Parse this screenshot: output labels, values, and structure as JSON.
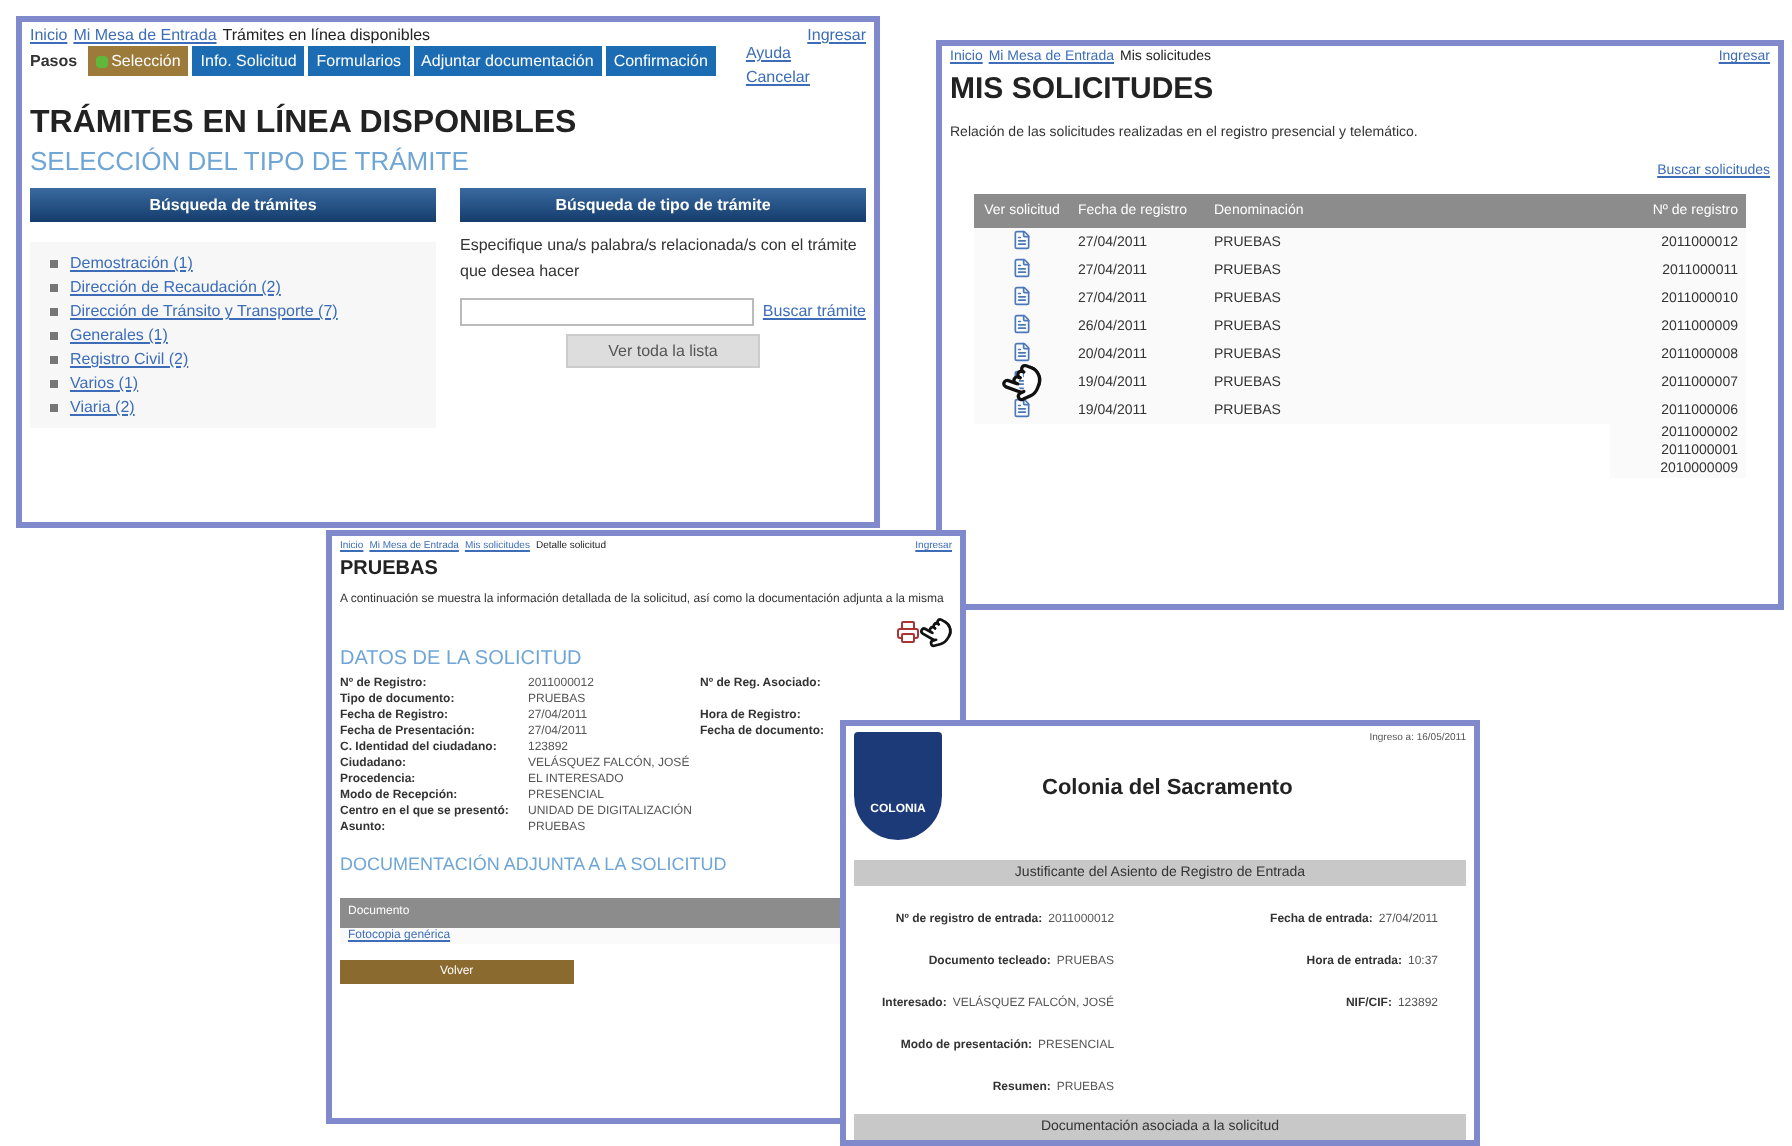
{
  "tramites": {
    "breadcrumb": {
      "links": [
        "Inicio",
        "Mi Mesa de Entrada"
      ],
      "current": "Trámites en línea disponibles"
    },
    "login": "Ingresar",
    "steps_label": "Pasos",
    "steps": [
      {
        "label": "Selección",
        "selected": true
      },
      {
        "label": "Info. Solicitud",
        "selected": false
      },
      {
        "label": "Formularios",
        "selected": false
      },
      {
        "label": "Adjuntar documentación",
        "selected": false
      },
      {
        "label": "Confirmación",
        "selected": false
      }
    ],
    "side_links": [
      "Ayuda",
      "Cancelar"
    ],
    "title": "TRÁMITES EN LÍNEA DISPONIBLES",
    "subtitle": "SELECCIÓN DEL TIPO DE TRÁMITE",
    "categories": {
      "header": "Búsqueda de trámites",
      "items": [
        "Demostración (1)",
        "Dirección de Recaudación (2)",
        "Dirección de Tránsito y Transporte (7)",
        "Generales (1)",
        "Registro Civil (2)",
        "Varios (1)",
        "Viaria (2)"
      ]
    },
    "search": {
      "header": "Búsqueda de tipo de trámite",
      "hint": "Especifique una/s palabra/s relacionada/s con el trámite que desea hacer",
      "link": "Buscar trámite",
      "button": "Ver toda la lista"
    }
  },
  "solicitudes": {
    "breadcrumb": {
      "links": [
        "Inicio",
        "Mi Mesa de Entrada"
      ],
      "current": "Mis solicitudes"
    },
    "login": "Ingresar",
    "title": "MIS SOLICITUDES",
    "intro": "Relación de las solicitudes realizadas en el registro presencial y telemático.",
    "search_link": "Buscar solicitudes",
    "columns": [
      "Ver solicitud",
      "Fecha de registro",
      "Denominación",
      "Nº de registro"
    ],
    "rows": [
      {
        "date": "27/04/2011",
        "name": "PRUEBAS",
        "number": "2011000012"
      },
      {
        "date": "27/04/2011",
        "name": "PRUEBAS",
        "number": "2011000011"
      },
      {
        "date": "27/04/2011",
        "name": "PRUEBAS",
        "number": "2011000010"
      },
      {
        "date": "26/04/2011",
        "name": "PRUEBAS",
        "number": "2011000009"
      },
      {
        "date": "20/04/2011",
        "name": "PRUEBAS",
        "number": "2011000008"
      },
      {
        "date": "19/04/2011",
        "name": "PRUEBAS",
        "number": "2011000007"
      },
      {
        "date": "19/04/2011",
        "name": "PRUEBAS",
        "number": "2011000006"
      },
      {
        "number": "2011000002"
      },
      {
        "number": "2011000001"
      },
      {
        "number": "2010000009"
      }
    ]
  },
  "detalle": {
    "breadcrumb": {
      "links": [
        "Inicio",
        "Mi Mesa de Entrada",
        "Mis solicitudes"
      ],
      "current": "Detalle solicitud"
    },
    "login": "Ingresar",
    "title": "PRUEBAS",
    "intro": "A continuación se muestra la información detallada de la solicitud, así como la documentación adjunta a la misma",
    "section": "DATOS DE LA SOLICITUD",
    "fields": [
      {
        "label": "Nº de Registro:",
        "value": "2011000012",
        "side_label": "Nº de Reg. Asociado:"
      },
      {
        "label": "Tipo de documento:",
        "value": "PRUEBAS"
      },
      {
        "label": "Fecha de Registro:",
        "value": "27/04/2011",
        "side_label": "Hora de Registro:"
      },
      {
        "label": "Fecha de Presentación:",
        "value": "27/04/2011",
        "side_label": "Fecha de documento:"
      },
      {
        "label": "C. Identidad del ciudadano:",
        "value": "123892"
      },
      {
        "label": "Ciudadano:",
        "value": "VELÁSQUEZ FALCÓN, JOSÉ"
      },
      {
        "label": "Procedencia:",
        "value": "EL INTERESADO"
      },
      {
        "label": "Modo de Recepción:",
        "value": "PRESENCIAL"
      },
      {
        "label": "Centro en el que se presentó:",
        "value": "UNIDAD DE DIGITALIZACIÓN"
      },
      {
        "label": "Asunto:",
        "value": "PRUEBAS"
      }
    ],
    "docs_section": "DOCUMENTACIÓN ADJUNTA A LA SOLICITUD",
    "doc_columns": [
      "Documento"
    ],
    "doc_rows": [
      "Fotocopia genérica"
    ],
    "button": "Volver"
  },
  "justificante": {
    "access": "Ingreso a: 16/05/2011",
    "logo_text": "COLONIA",
    "title": "Colonia del Sacramento",
    "band": "Justificante del Asiento de Registro de Entrada",
    "left": [
      {
        "label": "Nº de registro de entrada:",
        "value": "2011000012"
      },
      {
        "label": "Documento tecleado:",
        "value": "PRUEBAS"
      },
      {
        "label": "Interesado:",
        "value": "VELÁSQUEZ FALCÓN, JOSÉ"
      },
      {
        "label": "Modo de presentación:",
        "value": "PRESENCIAL"
      },
      {
        "label": "Resumen:",
        "value": "PRUEBAS"
      }
    ],
    "right": [
      {
        "label": "Fecha de entrada:",
        "value": "27/04/2011"
      },
      {
        "label": "Hora de entrada:",
        "value": "10:37"
      },
      {
        "label": "NIF/CIF:",
        "value": "123892"
      }
    ],
    "footer_band": "Documentación asociada a la solicitud"
  }
}
